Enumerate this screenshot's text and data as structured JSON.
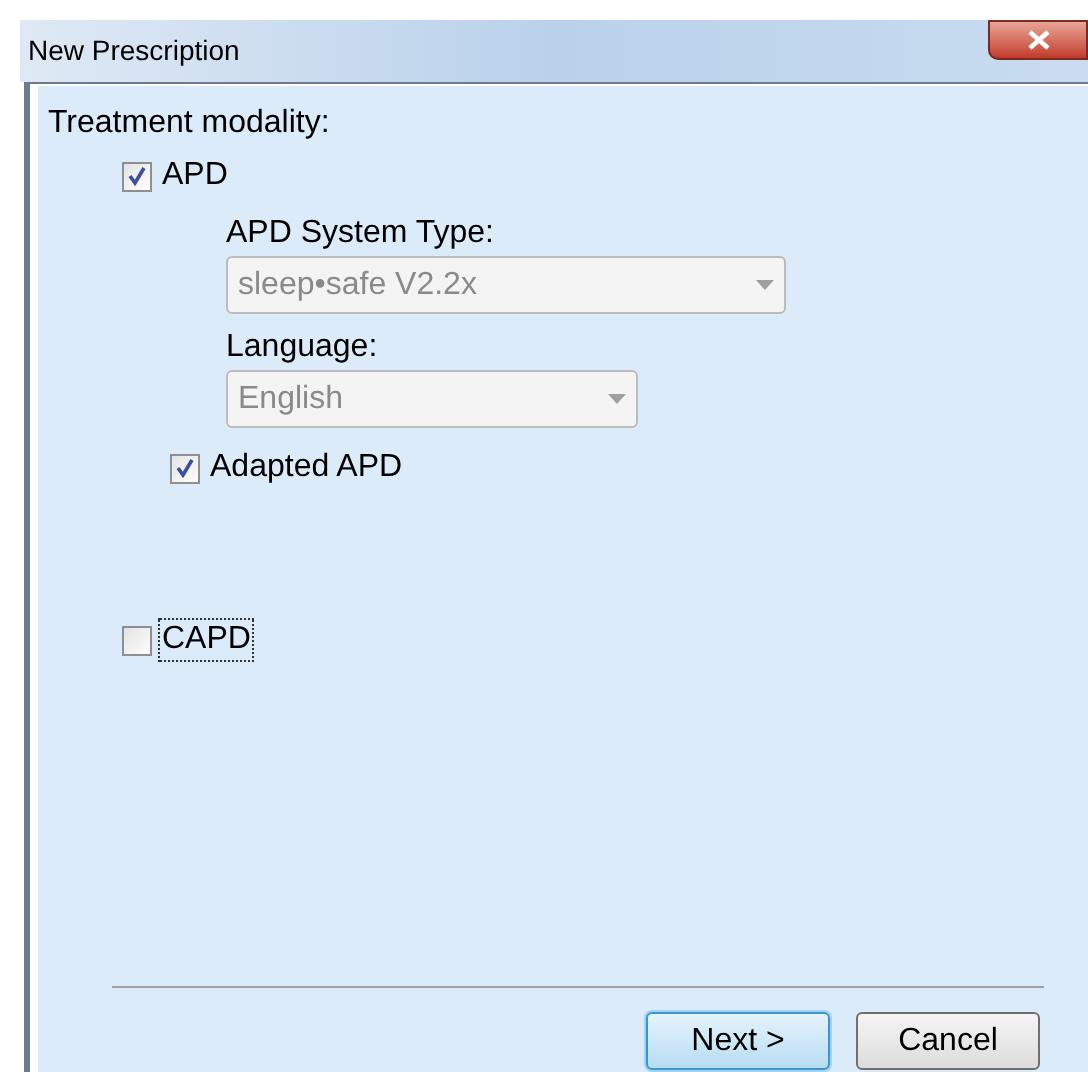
{
  "window": {
    "title": "New Prescription"
  },
  "heading": "Treatment modality:",
  "apd": {
    "label": "APD",
    "checked": true
  },
  "system_type": {
    "label": "APD System Type:",
    "value": "sleep•safe V2.2x",
    "disabled": true
  },
  "language": {
    "label": "Language:",
    "value": "English",
    "disabled": true
  },
  "adapted_apd": {
    "label": "Adapted APD",
    "checked": true
  },
  "capd": {
    "label": "CAPD",
    "checked": false,
    "focused": true
  },
  "buttons": [
    {
      "label": "Next >",
      "kind": "default"
    },
    {
      "label": "Cancel",
      "kind": "normal"
    }
  ]
}
